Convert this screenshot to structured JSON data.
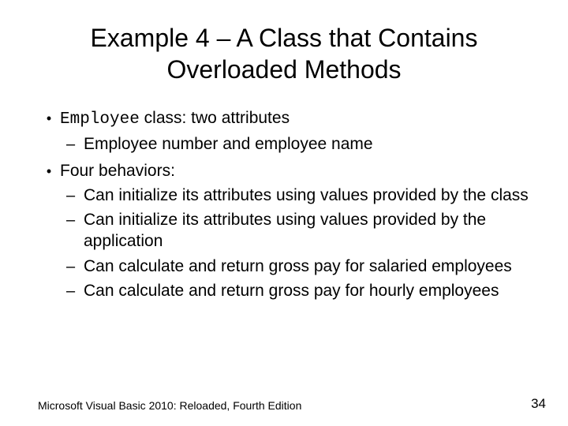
{
  "title_line1": "Example 4 – A Class that Contains",
  "title_line2": "Overloaded Methods",
  "bullets": [
    {
      "parts": [
        {
          "text": "Employee",
          "mono": true
        },
        {
          "text": " class: two attributes",
          "mono": false
        }
      ],
      "sub": [
        "Employee number and employee name"
      ]
    },
    {
      "parts": [
        {
          "text": "Four behaviors:",
          "mono": false
        }
      ],
      "sub": [
        "Can initialize its attributes using values provided by the class",
        "Can initialize its attributes using values provided by the application",
        "Can calculate and return gross pay for salaried employees",
        "Can calculate and return gross pay for hourly employees"
      ]
    }
  ],
  "footer_left": "Microsoft Visual Basic 2010: Reloaded, Fourth Edition",
  "footer_right": "34"
}
